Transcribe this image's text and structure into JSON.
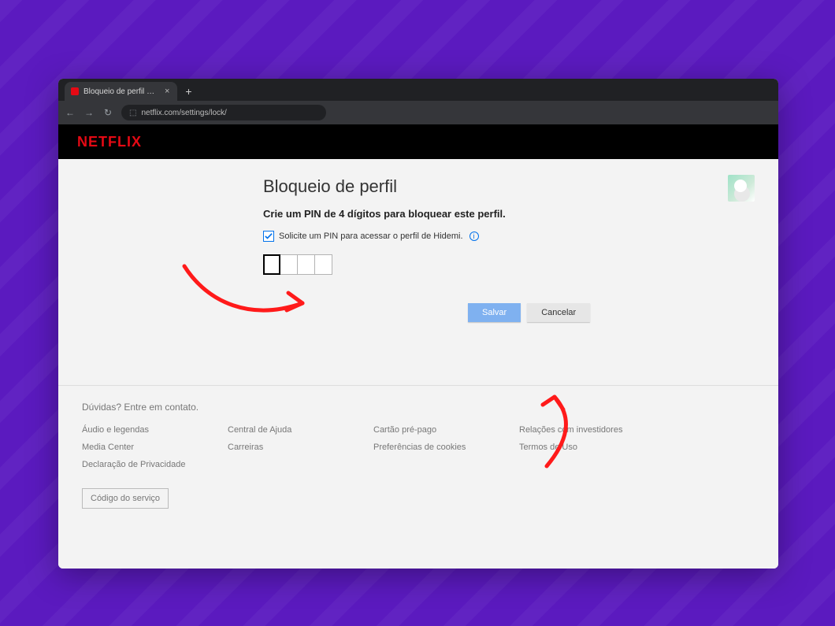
{
  "browser": {
    "tab_title": "Bloqueio de perfil – Conta – Ne",
    "url": "netflix.com/settings/lock/"
  },
  "header": {
    "logo_text": "NETFLIX"
  },
  "main": {
    "title": "Bloqueio de perfil",
    "subtitle": "Crie um PIN de 4 dígitos para bloquear este perfil.",
    "checkbox_label": "Solicite um PIN para acessar o perfil de Hidemi.",
    "checkbox_checked": true,
    "pin_length": 4,
    "save_label": "Salvar",
    "cancel_label": "Cancelar"
  },
  "footer": {
    "contact": "Dúvidas? Entre em contato.",
    "links": [
      "Áudio e legendas",
      "Central de Ajuda",
      "Cartão pré-pago",
      "Relações com investidores",
      "Media Center",
      "Carreiras",
      "Preferências de cookies",
      "Termos de Uso",
      "Declaração de Privacidade"
    ],
    "service_code": "Código do serviço"
  }
}
